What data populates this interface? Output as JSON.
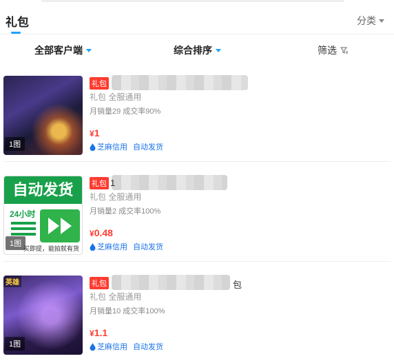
{
  "header": {
    "tab_label": "礼包",
    "category_label": "分类"
  },
  "filters": {
    "client": "全部客户端",
    "sort": "综合排序",
    "screen": "筛选"
  },
  "items": [
    {
      "tag": "礼包",
      "title_suffix": "",
      "sub": "礼包  全服通用",
      "stats": "月销量29 成交率90%",
      "price_symbol": "¥",
      "price": "1",
      "badge1": "芝麻信用",
      "badge2": "自动发货",
      "thumb_badge": "1图"
    },
    {
      "tag": "礼包",
      "title_suffix": "1",
      "sub": "礼包  全服通用",
      "stats": "月销量2 成交率100%",
      "price_symbol": "¥",
      "price": "0.48",
      "badge1": "芝麻信用",
      "badge2": "自动发货",
      "thumb_badge": "1图",
      "thumb_text_top": "自动发货",
      "thumb_text_24": "24小时",
      "thumb_text_foot": "买即提，能拍就有货"
    },
    {
      "tag": "礼包",
      "title_suffix": "包",
      "sub": "礼包  全服通用",
      "stats": "月销量10 成交率100%",
      "price_symbol": "¥",
      "price": "1.1",
      "badge1": "芝麻信用",
      "badge2": "自动发货",
      "thumb_badge": "1图",
      "thumb_corner": "英雄"
    }
  ],
  "colors": {
    "accent": "#1aa3ff",
    "price": "#ff3b30",
    "badge_text": "#1a73e8"
  }
}
